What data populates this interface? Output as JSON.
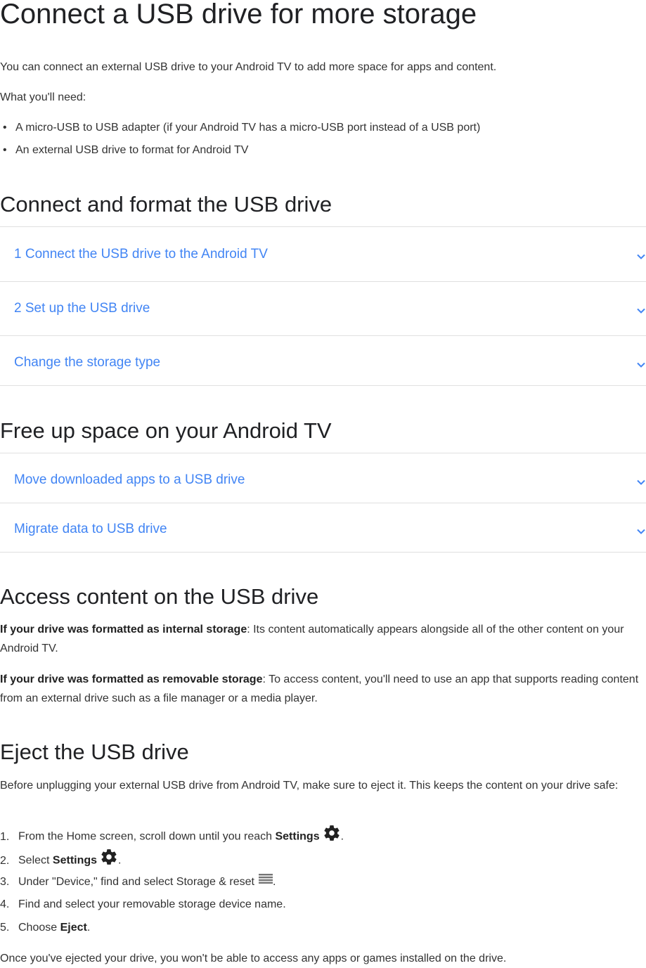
{
  "title": "Connect a USB drive for more storage",
  "intro": "You can connect an external USB drive to your Android TV to add more space for apps and content.",
  "need_label": "What you'll need:",
  "needs": [
    "A micro-USB to USB adapter (if your Android TV has a micro-USB port instead of a USB port)",
    "An external USB drive to format for Android TV"
  ],
  "section_connect": {
    "heading": "Connect and format the USB drive",
    "items": [
      "1 Connect the USB drive to the Android TV",
      "2 Set up the USB drive",
      "Change the storage type"
    ]
  },
  "section_free": {
    "heading": "Free up space on your Android TV",
    "items": [
      "Move downloaded apps to a USB drive",
      "Migrate data to USB drive"
    ]
  },
  "section_access": {
    "heading": "Access content on the USB drive",
    "p1_bold": "If your drive was formatted as internal storage",
    "p1_rest": ": Its content automatically appears alongside all of the other content on your Android TV.",
    "p2_bold": "If your drive was formatted as removable storage",
    "p2_rest": ": To access content, you'll need to use an app that supports reading content from an external drive such as a file manager or a media player."
  },
  "section_eject": {
    "heading": "Eject the USB drive",
    "intro": "Before unplugging your external USB drive from Android TV, make sure to eject it. This keeps the content on your drive safe:",
    "steps": [
      {
        "num": "1.",
        "pre": "From the Home screen, scroll down until you reach ",
        "bold": "Settings",
        "post": ".",
        "icon": "gear-icon"
      },
      {
        "num": "2.",
        "pre": "Select ",
        "bold": "Settings",
        "post": ".",
        "icon": "gear-icon"
      },
      {
        "num": "3.",
        "pre": "Under \"Device,\" find and select Storage & reset",
        "bold": "",
        "post": ".",
        "icon": "storage-menu-icon"
      },
      {
        "num": "4.",
        "pre": "Find and select your removable storage device name.",
        "bold": "",
        "post": "",
        "icon": ""
      },
      {
        "num": "5.",
        "pre": "Choose ",
        "bold": "Eject",
        "post": ".",
        "icon": ""
      }
    ],
    "outro": "Once you've ejected your drive, you won't be able to access any apps or games installed on the drive."
  },
  "colors": {
    "link": "#4285f4",
    "divider": "#e0e0e0"
  }
}
